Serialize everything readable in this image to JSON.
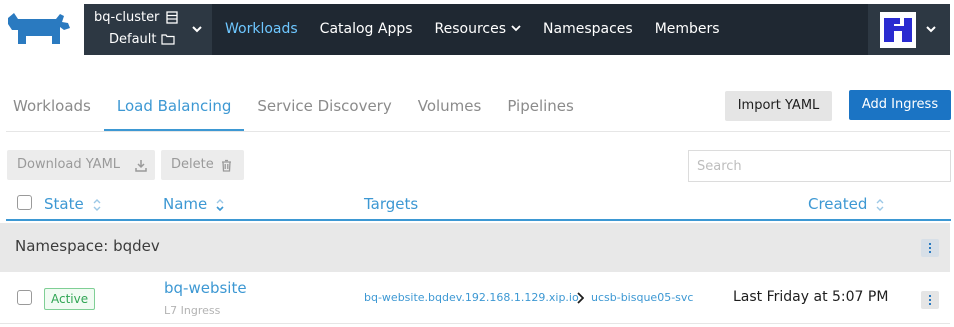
{
  "header": {
    "cluster_name": "bq-cluster",
    "project_name": "Default",
    "nav": [
      {
        "label": "Workloads",
        "active": true
      },
      {
        "label": "Catalog Apps"
      },
      {
        "label": "Resources",
        "dropdown": true
      },
      {
        "label": "Namespaces"
      },
      {
        "label": "Members"
      }
    ]
  },
  "subtabs": [
    {
      "label": "Workloads"
    },
    {
      "label": "Load Balancing",
      "active": true
    },
    {
      "label": "Service Discovery"
    },
    {
      "label": "Volumes"
    },
    {
      "label": "Pipelines"
    }
  ],
  "actions": {
    "import_yaml": "Import YAML",
    "add_ingress": "Add Ingress"
  },
  "bulk": {
    "download_yaml": "Download YAML",
    "delete": "Delete"
  },
  "search": {
    "placeholder": "Search"
  },
  "table": {
    "columns": {
      "state": "State",
      "name": "Name",
      "targets": "Targets",
      "created": "Created"
    },
    "group_label": "Namespace: bqdev",
    "rows": [
      {
        "state": "Active",
        "name": "bq-website",
        "type": "L7 Ingress",
        "target_host": "bq-website.bqdev.192.168.1.129.xip.io",
        "target_service": "ucsb-bisque05-svc",
        "created": "Last Friday at 5:07 PM"
      }
    ]
  },
  "colors": {
    "accent": "#3d98d3",
    "nav_bg": "#1f2832",
    "primary_button": "#1b74c4",
    "active_badge": "#2fa553",
    "logo": "#2a7ac0"
  },
  "icons": [
    "rancher-logo",
    "cluster-icon",
    "folder-icon",
    "chevron-down-icon",
    "download-icon",
    "trash-icon",
    "sort-icon",
    "kebab-menu-icon",
    "chevron-right-icon",
    "user-avatar"
  ]
}
